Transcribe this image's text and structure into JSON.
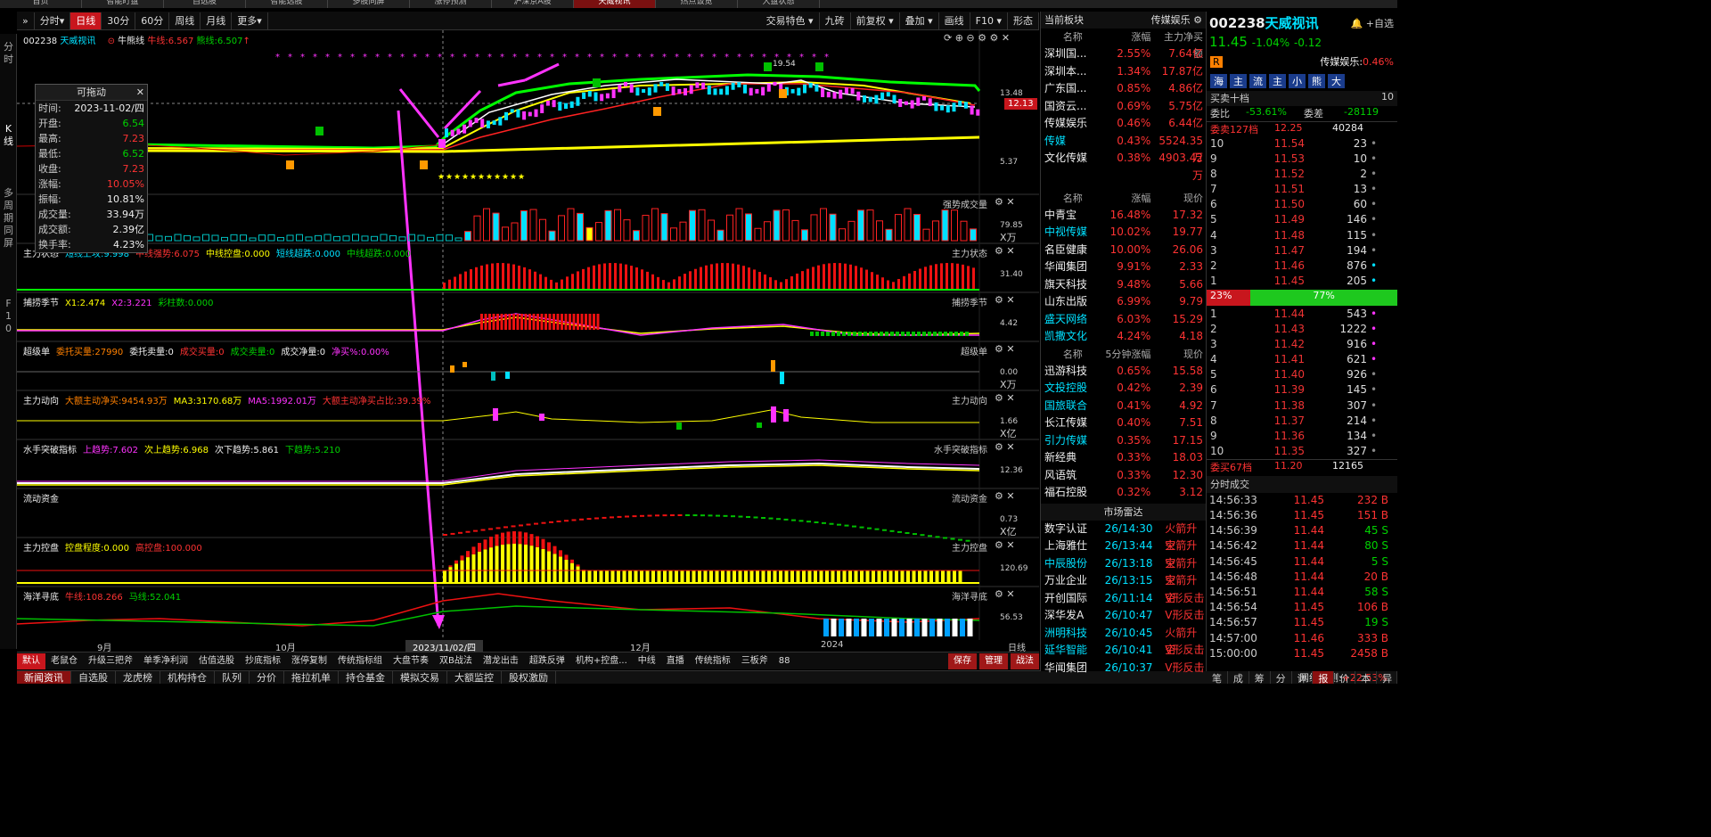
{
  "top_tabs": [
    "首页",
    "智能盯盘",
    "自选股",
    "智能选股",
    "多股同屏",
    "涨停预测",
    "沪深京A股",
    "天威视讯",
    "热点饭览",
    "大盘状态"
  ],
  "left_strip": [
    "分",
    "时",
    "K",
    "线",
    "多",
    "周",
    "期",
    "同",
    "屏",
    "F",
    "1",
    "0"
  ],
  "toolbar": {
    "items": [
      "分时▾",
      "日线",
      "30分",
      "60分",
      "周线",
      "月线",
      "更多▾"
    ],
    "active": "日线",
    "right": [
      "交易特色 ▾",
      "九砖",
      "前复权 ▾",
      "叠加 ▾",
      "画线",
      "F10 ▾",
      "形态"
    ]
  },
  "main_header": {
    "code": "002238",
    "name": "天威视讯",
    "indicator": "牛熊线",
    "bull_label": "牛线:6.567",
    "bear_label": "熊线:6.507",
    "y_high": "13.48",
    "price_tag": "12.13",
    "y_low": "5.37",
    "cursor_price": "19.54"
  },
  "popup": {
    "title": "可拖动",
    "rows": [
      [
        "时间:",
        "2023-11-02/四",
        "white"
      ],
      [
        "开盘:",
        "6.54",
        "green"
      ],
      [
        "最高:",
        "7.23",
        "red"
      ],
      [
        "最低:",
        "6.52",
        "green"
      ],
      [
        "收盘:",
        "7.23",
        "red"
      ],
      [
        "涨幅:",
        "10.05%",
        "red"
      ],
      [
        "振幅:",
        "10.81%",
        "white"
      ],
      [
        "成交量:",
        "33.94万",
        "white"
      ],
      [
        "成交额:",
        "2.39亿",
        "white"
      ],
      [
        "换手率:",
        "4.23%",
        "white"
      ]
    ]
  },
  "panels": [
    {
      "title": "强势成交量",
      "y": "79.85",
      "unit": "X万",
      "labels": []
    },
    {
      "title": "主力状态",
      "y": "31.40",
      "unit": "",
      "labels": [
        [
          "主力状态",
          "white"
        ],
        [
          "短线上攻:9.998",
          "cyan"
        ],
        [
          "中线强势:6.075",
          "red"
        ],
        [
          "中线控盘:0.000",
          "yellow"
        ],
        [
          "短线超跌:0.000",
          "cyan"
        ],
        [
          "中线超跌:0.000",
          "green"
        ]
      ]
    },
    {
      "title": "捕捞季节",
      "y": "4.42",
      "unit": "",
      "labels": [
        [
          "捕捞季节",
          "white"
        ],
        [
          "X1:2.474",
          "yellow"
        ],
        [
          "X2:3.221",
          "mag"
        ],
        [
          "彩柱数:0.000",
          "green"
        ]
      ]
    },
    {
      "title": "超级单",
      "y": "0.00",
      "unit": "X万",
      "labels": [
        [
          "超级单",
          "white"
        ],
        [
          "委托买量:27990",
          "orange"
        ],
        [
          "委托卖量:0",
          "white"
        ],
        [
          "成交买量:0",
          "red"
        ],
        [
          "成交卖量:0",
          "green"
        ],
        [
          "成交净量:0",
          "white"
        ],
        [
          "净买%:0.00%",
          "mag"
        ]
      ]
    },
    {
      "title": "主力动向",
      "y": "1.66",
      "unit": "X亿",
      "labels": [
        [
          "主力动向",
          "white"
        ],
        [
          "大额主动净买:9454.93万",
          "orange"
        ],
        [
          "MA3:3170.68万",
          "yellow"
        ],
        [
          "MA5:1992.01万",
          "mag"
        ],
        [
          "大额主动净买占比:39.39%",
          "red"
        ]
      ]
    },
    {
      "title": "水手突破指标",
      "y": "12.36",
      "unit": "",
      "labels": [
        [
          "水手突破指标",
          "white"
        ],
        [
          "上趋势:7.602",
          "mag"
        ],
        [
          "次上趋势:6.968",
          "yellow"
        ],
        [
          "次下趋势:5.861",
          "white"
        ],
        [
          "下趋势:5.210",
          "green"
        ]
      ]
    },
    {
      "title": "流动资金",
      "y": "0.73",
      "unit": "X亿",
      "labels": [
        [
          "流动资金",
          "white"
        ]
      ]
    },
    {
      "title": "主力控盘",
      "y": "120.69",
      "unit": "",
      "labels": [
        [
          "主力控盘",
          "white"
        ],
        [
          "控盘程度:0.000",
          "yellow"
        ],
        [
          "高控盘:100.000",
          "red"
        ]
      ]
    },
    {
      "title": "海洋寻底",
      "y": "56.53",
      "unit": "",
      "labels": [
        [
          "海洋寻底",
          "white"
        ],
        [
          "牛线:108.266",
          "red"
        ],
        [
          "马线:52.041",
          "green"
        ]
      ]
    }
  ],
  "xaxis": {
    "labels": [
      "9月",
      "10月",
      "12月",
      "2024"
    ],
    "cursor_date": "2023/11/02/四",
    "period": "日线"
  },
  "bottom_tabs": {
    "items": [
      "默认",
      "老鼠仓",
      "升级三把斧",
      "单季净利润",
      "估值选股",
      "抄底指标",
      "涨停复制",
      "传统指标组",
      "大盘节奏",
      "双B战法",
      "潜龙出击",
      "超跌反弹",
      "机构+控盘...",
      "中线",
      "直播",
      "传统指标",
      "三板斧",
      "88"
    ],
    "active": "默认",
    "right": [
      "保存",
      "管理",
      "战法"
    ]
  },
  "news_bar": {
    "items": [
      "新闻资讯",
      "自选股",
      "龙虎榜",
      "机构持仓",
      "队列",
      "分价",
      "拖拉机单",
      "持仓基金",
      "模拟交易",
      "大额监控",
      "股权激励"
    ],
    "active": "新闻资讯",
    "net_label": "网络优测:",
    "net_value": "+22.53%"
  },
  "sector": {
    "header": "当前板块",
    "current": "传媒娱乐",
    "head1": [
      "名称",
      "涨幅",
      "主力净买额"
    ],
    "rows1": [
      [
        "深圳国...",
        "2.55%",
        "7.64亿",
        "white"
      ],
      [
        "深圳本...",
        "1.34%",
        "17.87亿",
        "white"
      ],
      [
        "广东国...",
        "0.85%",
        "4.86亿",
        "white"
      ],
      [
        "国资云...",
        "0.69%",
        "5.75亿",
        "white"
      ],
      [
        "传媒娱乐",
        "0.46%",
        "6.44亿",
        "white"
      ],
      [
        "传媒",
        "0.43%",
        "5524.35万",
        "cyan"
      ],
      [
        "文化传媒",
        "0.38%",
        "4903.42万",
        "white"
      ]
    ],
    "head2": [
      "名称",
      "涨幅",
      "现价"
    ],
    "rows2": [
      [
        "中青宝",
        "16.48%",
        "17.32",
        "white"
      ],
      [
        "中视传媒",
        "10.02%",
        "19.77",
        "cyan"
      ],
      [
        "名臣健康",
        "10.00%",
        "26.06",
        "white"
      ],
      [
        "华闻集团",
        "9.91%",
        "2.33",
        "white"
      ],
      [
        "旗天科技",
        "9.48%",
        "5.66",
        "white"
      ],
      [
        "山东出版",
        "6.99%",
        "9.79",
        "white"
      ],
      [
        "盛天网络",
        "6.03%",
        "15.29",
        "cyan"
      ],
      [
        "凯撒文化",
        "4.24%",
        "4.18",
        "cyan"
      ]
    ],
    "head3": [
      "名称",
      "5分钟涨幅",
      "现价"
    ],
    "rows3": [
      [
        "迅游科技",
        "0.65%",
        "15.58",
        "white"
      ],
      [
        "文投控股",
        "0.42%",
        "2.39",
        "cyan"
      ],
      [
        "国旅联合",
        "0.41%",
        "4.92",
        "cyan"
      ],
      [
        "长江传媒",
        "0.40%",
        "7.51",
        "white"
      ],
      [
        "引力传媒",
        "0.35%",
        "17.15",
        "cyan"
      ],
      [
        "新经典",
        "0.33%",
        "18.03",
        "white"
      ],
      [
        "风语筑",
        "0.33%",
        "12.30",
        "white"
      ],
      [
        "福石控股",
        "0.32%",
        "3.12",
        "white"
      ]
    ],
    "radar_title": "市场雷达",
    "radar": [
      [
        "数字认证",
        "26/14:30",
        "火箭升空",
        "white"
      ],
      [
        "上海雅仕",
        "26/13:44",
        "火箭升空",
        "white"
      ],
      [
        "中辰股份",
        "26/13:18",
        "火箭升空",
        "cyan"
      ],
      [
        "万业企业",
        "26/13:15",
        "火箭升空",
        "white"
      ],
      [
        "开创国际",
        "26/11:14",
        "V形反击",
        "white"
      ],
      [
        "深华发A",
        "26/10:47",
        "V形反击",
        "white"
      ],
      [
        "洲明科技",
        "26/10:45",
        "火箭升空",
        "cyan"
      ],
      [
        "延华智能",
        "26/10:41",
        "V形反击",
        "cyan"
      ],
      [
        "华闻集团",
        "26/10:37",
        "V形反击",
        "white"
      ]
    ]
  },
  "stock": {
    "code": "002238",
    "name": "天威视讯",
    "price": "11.45",
    "change": "-1.04%",
    "change_abs": "-0.12",
    "sector": "传媒娱乐:",
    "sector_pct": "0.46%",
    "add_label": "+自选",
    "tags": [
      "海",
      "主",
      "流",
      "主",
      "小",
      "熊",
      "大"
    ],
    "depth_title": "买卖十档",
    "depth_level": "10",
    "weibi_label": "委比",
    "weibi": "-53.61%",
    "weicha_label": "委差",
    "weicha": "-28119",
    "sell_header": [
      "委卖127档",
      "12.25",
      "40284"
    ],
    "sells": [
      [
        "10",
        "11.54",
        "23"
      ],
      [
        "9",
        "11.53",
        "10"
      ],
      [
        "8",
        "11.52",
        "2"
      ],
      [
        "7",
        "11.51",
        "13"
      ],
      [
        "6",
        "11.50",
        "60"
      ],
      [
        "5",
        "11.49",
        "146"
      ],
      [
        "4",
        "11.48",
        "115"
      ],
      [
        "3",
        "11.47",
        "194"
      ],
      [
        "2",
        "11.46",
        "876"
      ],
      [
        "1",
        "11.45",
        "205"
      ]
    ],
    "ratio_left": "23%",
    "ratio_right": "77%",
    "buys": [
      [
        "1",
        "11.44",
        "543"
      ],
      [
        "2",
        "11.43",
        "1222"
      ],
      [
        "3",
        "11.42",
        "916"
      ],
      [
        "4",
        "11.41",
        "621"
      ],
      [
        "5",
        "11.40",
        "926"
      ],
      [
        "6",
        "11.39",
        "145"
      ],
      [
        "7",
        "11.38",
        "307"
      ],
      [
        "8",
        "11.37",
        "214"
      ],
      [
        "9",
        "11.36",
        "134"
      ],
      [
        "10",
        "11.35",
        "327"
      ]
    ],
    "buy_footer": [
      "委买67档",
      "11.20",
      "12165"
    ],
    "trades_title": "分时成交",
    "trades": [
      [
        "14:56:33",
        "11.45",
        "232 B"
      ],
      [
        "14:56:36",
        "11.45",
        "151 B"
      ],
      [
        "14:56:39",
        "11.44",
        "45 S"
      ],
      [
        "14:56:42",
        "11.44",
        "80 S"
      ],
      [
        "14:56:45",
        "11.44",
        "5 S"
      ],
      [
        "14:56:48",
        "11.44",
        "20 B"
      ],
      [
        "14:56:51",
        "11.44",
        "58 S"
      ],
      [
        "14:56:54",
        "11.45",
        "106 B"
      ],
      [
        "14:56:57",
        "11.45",
        "19 S"
      ],
      [
        "14:57:00",
        "11.46",
        "333 B"
      ],
      [
        "15:00:00",
        "11.45",
        "2458 B"
      ]
    ],
    "footer_tabs": [
      "笔",
      "成",
      "筹",
      "分",
      "详",
      "报",
      "价",
      "本",
      "异"
    ]
  },
  "top_right": {
    "zoom": "105%"
  }
}
